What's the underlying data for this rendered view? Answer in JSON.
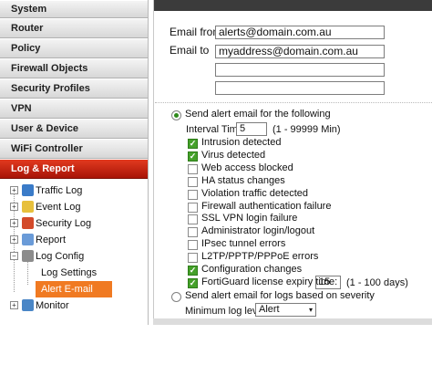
{
  "nav": {
    "items": [
      {
        "label": "System"
      },
      {
        "label": "Router"
      },
      {
        "label": "Policy"
      },
      {
        "label": "Firewall Objects"
      },
      {
        "label": "Security Profiles"
      },
      {
        "label": "VPN"
      },
      {
        "label": "User & Device"
      },
      {
        "label": "WiFi Controller"
      },
      {
        "label": "Log & Report"
      }
    ],
    "active_index": 8
  },
  "tree": {
    "traffic_log": "Traffic Log",
    "event_log": "Event Log",
    "security_log": "Security Log",
    "report": "Report",
    "log_config": "Log Config",
    "log_settings": "Log Settings",
    "alert_email": "Alert E-mail",
    "monitor": "Monitor"
  },
  "form": {
    "email_from_label": "Email from",
    "email_from_value": "alerts@domain.com.au",
    "email_to_label": "Email to",
    "email_to_values": [
      "myaddress@domain.com.au",
      "",
      ""
    ],
    "radio_following_label": "Send alert email for the following",
    "interval_label": "Interval Time:",
    "interval_value": "5",
    "interval_range": "(1 - 99999 Min)",
    "checks": [
      {
        "label": "Intrusion detected",
        "checked": true
      },
      {
        "label": "Virus detected",
        "checked": true
      },
      {
        "label": "Web access blocked",
        "checked": false
      },
      {
        "label": "HA status changes",
        "checked": false
      },
      {
        "label": "Violation traffic detected",
        "checked": false
      },
      {
        "label": "Firewall authentication failure",
        "checked": false
      },
      {
        "label": "SSL VPN login failure",
        "checked": false
      },
      {
        "label": "Administrator login/logout",
        "checked": false
      },
      {
        "label": "IPsec tunnel errors",
        "checked": false
      },
      {
        "label": "L2TP/PPTP/PPPoE errors",
        "checked": false
      },
      {
        "label": "Configuration changes",
        "checked": true
      },
      {
        "label": "FortiGuard license expiry time:",
        "checked": true
      }
    ],
    "license_days_value": "15",
    "license_days_range": "(1 - 100 days)",
    "radio_severity_label": "Send alert email for logs based on severity",
    "min_log_level_label": "Minimum log level:",
    "min_log_level_value": "Alert"
  }
}
